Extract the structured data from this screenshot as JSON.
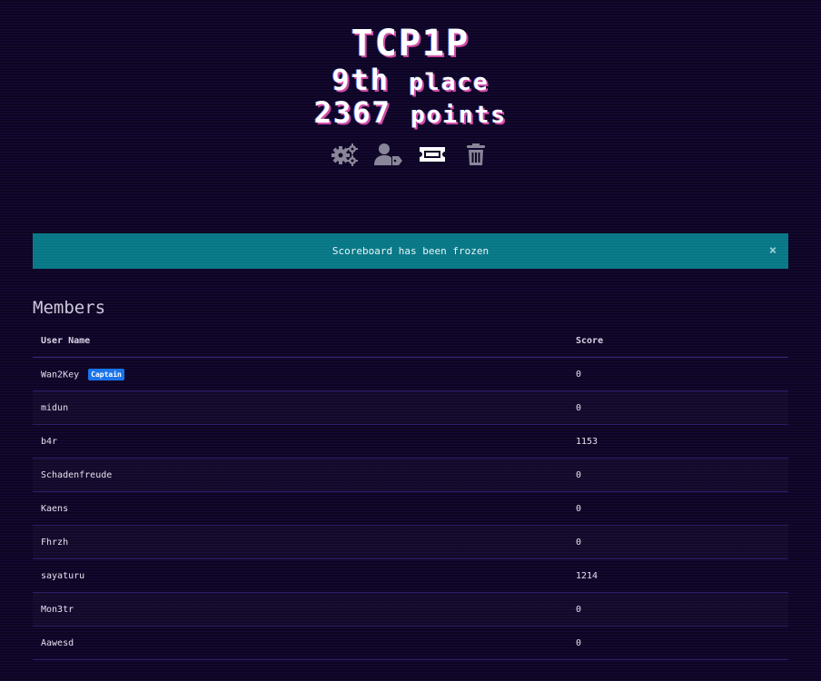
{
  "team": {
    "name": "TCP1P",
    "place_number": "9th",
    "place_word": "place",
    "points_number": "2367",
    "points_word": "points"
  },
  "actions": [
    {
      "icon": "gears-icon",
      "label": "Settings"
    },
    {
      "icon": "user-tag-icon",
      "label": "Captain"
    },
    {
      "icon": "ticket-icon",
      "label": "Invite"
    },
    {
      "icon": "trash-icon",
      "label": "Delete"
    }
  ],
  "alert": {
    "message": "Scoreboard has been frozen",
    "close_glyph": "×"
  },
  "members": {
    "title": "Members",
    "columns": [
      "User Name",
      "Score"
    ],
    "captain_badge": "Captain",
    "rows": [
      {
        "name": "Wan2Key",
        "score": "0"
      },
      {
        "name": "midun",
        "score": "0"
      },
      {
        "name": "b4r",
        "score": "1153"
      },
      {
        "name": "Schadenfreude",
        "score": "0"
      },
      {
        "name": "Kaens",
        "score": "0"
      },
      {
        "name": "Fhrzh",
        "score": "0"
      },
      {
        "name": "sayaturu",
        "score": "1214"
      },
      {
        "name": "Mon3tr",
        "score": "0"
      },
      {
        "name": "Aawesd",
        "score": "0"
      }
    ]
  },
  "colors": {
    "background": "#0d0522",
    "alert": "#0a7b8a",
    "badge": "#1a73e8",
    "icon": "#8a8699"
  }
}
